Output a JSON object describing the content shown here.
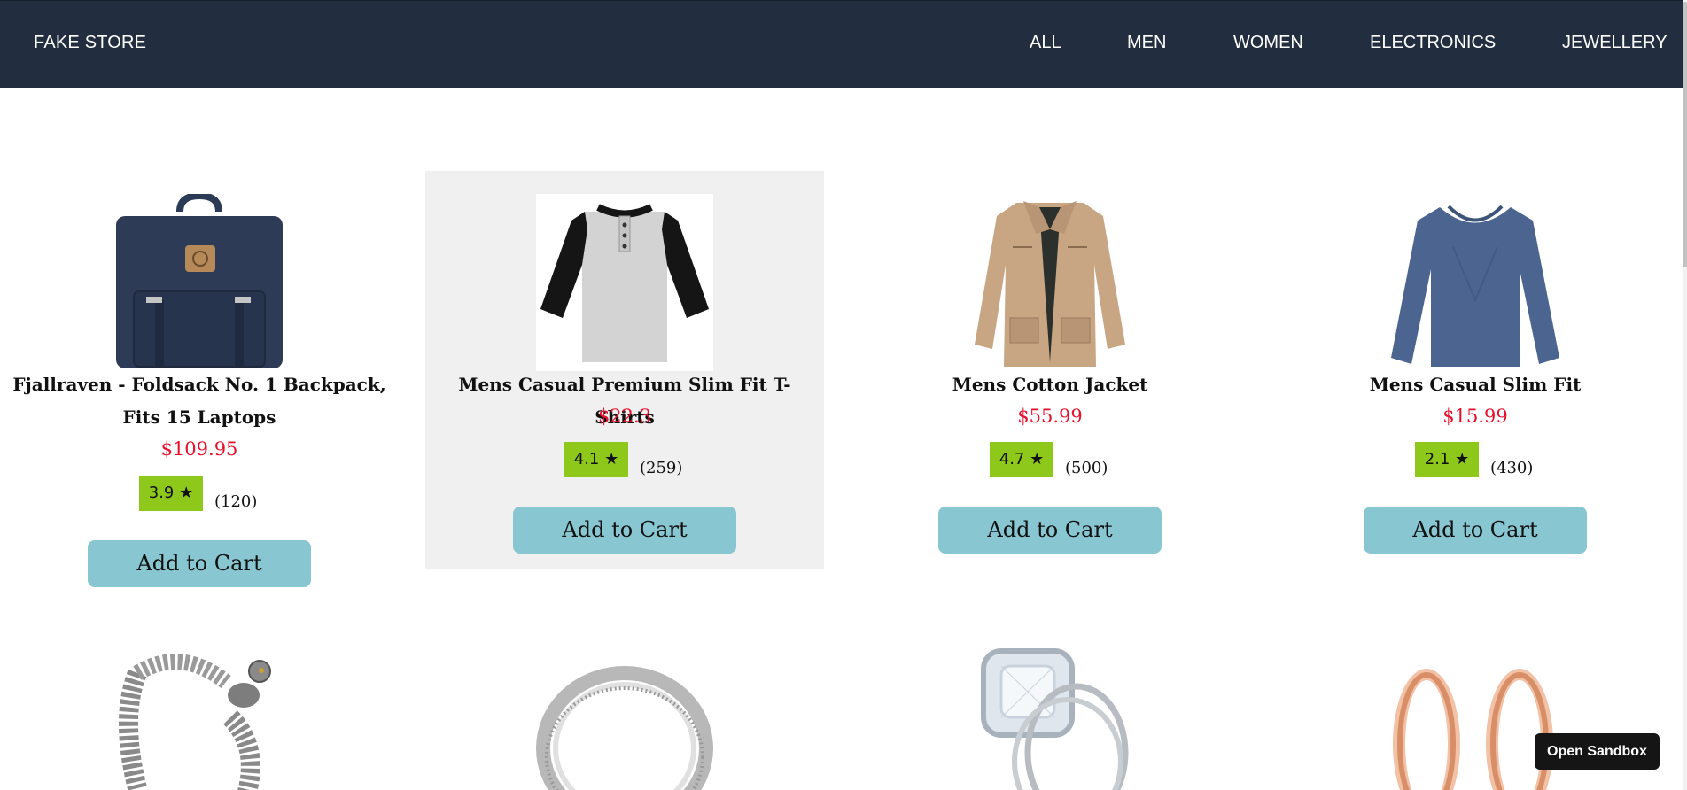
{
  "brand": "FAKE STORE",
  "nav": [
    "ALL",
    "MEN",
    "WOMEN",
    "ELECTRONICS",
    "JEWELLERY"
  ],
  "products": [
    {
      "title": "Fjallraven - Foldsack No. 1 Backpack, Fits 15 Laptops",
      "price": "$109.95",
      "rating": "3.9 ★",
      "count": "(120)",
      "button": "Add to Cart"
    },
    {
      "title": "Mens Casual Premium Slim Fit T-Shirts",
      "price": "$22.3",
      "rating": "4.1 ★",
      "count": "(259)",
      "button": "Add to Cart"
    },
    {
      "title": "Mens Cotton Jacket",
      "price": "$55.99",
      "rating": "4.7 ★",
      "count": "(500)",
      "button": "Add to Cart"
    },
    {
      "title": "Mens Casual Slim Fit",
      "price": "$15.99",
      "rating": "2.1 ★",
      "count": "(430)",
      "button": "Add to Cart"
    }
  ],
  "colors": {
    "navbar": "#222e3f",
    "price": "#e8112d",
    "rating_badge": "#8dc81b",
    "button": "#88c7d2",
    "hover_card": "#f0f0f1"
  },
  "icons": [
    "backpack-image",
    "raglan-tshirt-image",
    "cotton-jacket-image",
    "slim-fit-shirt-image",
    "dragon-bracelet-image",
    "silver-ring-image",
    "diamond-ring-image",
    "rose-gold-plugs-image"
  ],
  "sandbox_button": "Open Sandbox"
}
